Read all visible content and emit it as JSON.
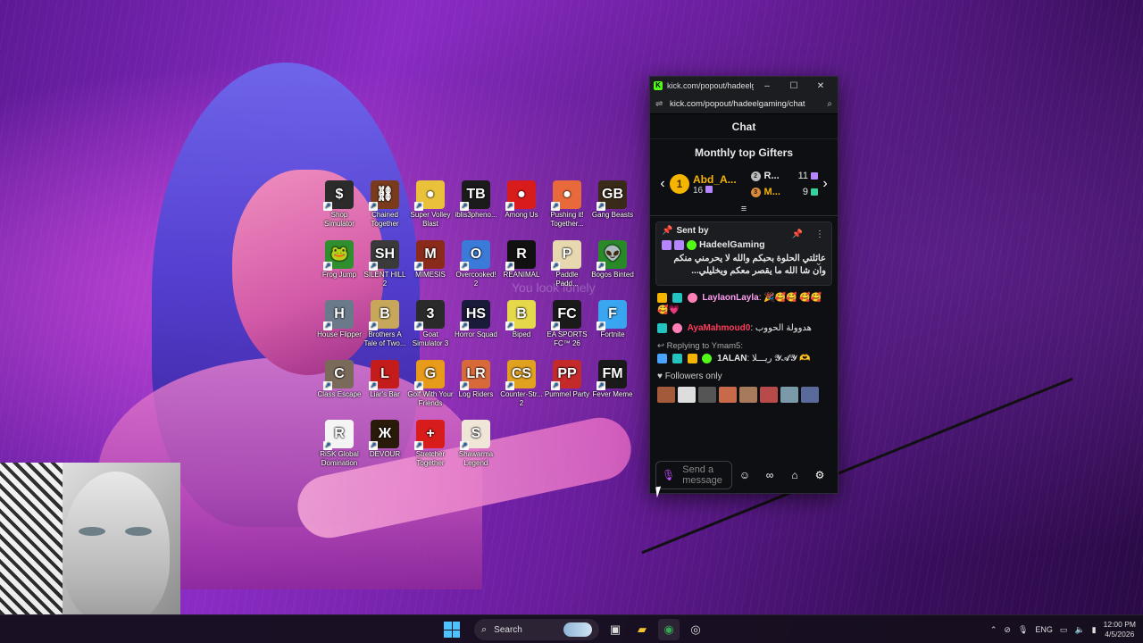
{
  "desktop": {
    "overlay_text": "You look lonely",
    "icons": [
      {
        "label": "Shop Simulator",
        "color": "#2b2b2b",
        "glyph": "$"
      },
      {
        "label": "Chained Together",
        "color": "#7a3b1c",
        "glyph": "⛓"
      },
      {
        "label": "Super Volley Blast",
        "color": "#e9c13a",
        "glyph": "●"
      },
      {
        "label": "iblis3pheno...",
        "color": "#1b1b1b",
        "glyph": "TB"
      },
      {
        "label": "Among Us",
        "color": "#d81b1b",
        "glyph": "●"
      },
      {
        "label": "Pushing it! Together...",
        "color": "#e86a3a",
        "glyph": "●"
      },
      {
        "label": "Gang Beasts",
        "color": "#3a2a1a",
        "glyph": "GB"
      },
      {
        "label": "Frog Jump",
        "color": "#2f8f2f",
        "glyph": "🐸"
      },
      {
        "label": "SILENT HILL 2",
        "color": "#3a3a3a",
        "glyph": "SH"
      },
      {
        "label": "MIMESIS",
        "color": "#8a2a1a",
        "glyph": "M"
      },
      {
        "label": "Overcooked! 2",
        "color": "#3a7ad8",
        "glyph": "O"
      },
      {
        "label": "REANIMAL",
        "color": "#111111",
        "glyph": "R"
      },
      {
        "label": "Paddle Padd...",
        "color": "#e7d8b0",
        "glyph": "P"
      },
      {
        "label": "Bogos Binted",
        "color": "#2a8a2a",
        "glyph": "👽"
      },
      {
        "label": "House Flipper",
        "color": "#6a7a8a",
        "glyph": "H"
      },
      {
        "label": "Brothers A Tale of Two...",
        "color": "#c7a85a",
        "glyph": "B"
      },
      {
        "label": "Goat Simulator 3",
        "color": "#2a2a2a",
        "glyph": "3"
      },
      {
        "label": "Horror Squad",
        "color": "#1a1a3a",
        "glyph": "HS"
      },
      {
        "label": "Biped",
        "color": "#e5d84a",
        "glyph": "B"
      },
      {
        "label": "EA SPORTS FC™ 26",
        "color": "#1a1a1a",
        "glyph": "FC"
      },
      {
        "label": "Fortnite",
        "color": "#3aa5f0",
        "glyph": "F"
      },
      {
        "label": "Class Escape",
        "color": "#7a6a5a",
        "glyph": "C"
      },
      {
        "label": "Liar's Bar",
        "color": "#c41b1b",
        "glyph": "L"
      },
      {
        "label": "Golf With Your Friends",
        "color": "#e89a1a",
        "glyph": "G"
      },
      {
        "label": "Log Riders",
        "color": "#d86a3a",
        "glyph": "LR"
      },
      {
        "label": "Counter-Str... 2",
        "color": "#e0a020",
        "glyph": "CS"
      },
      {
        "label": "Pummel Party",
        "color": "#c42a2a",
        "glyph": "PP"
      },
      {
        "label": "Fever Meme",
        "color": "#1a1a1a",
        "glyph": "FM"
      },
      {
        "label": "RiSK Global Domination",
        "color": "#f4f4f4",
        "glyph": "R"
      },
      {
        "label": "DEVOUR",
        "color": "#2a1a0a",
        "glyph": "Ж"
      },
      {
        "label": "Stretcher Together",
        "color": "#d81b1b",
        "glyph": "+"
      },
      {
        "label": "Shawarma Legend",
        "color": "#f0e6d8",
        "glyph": "S"
      }
    ]
  },
  "popup": {
    "title": "kick.com/popout/hadeelga...",
    "url": "kick.com/popout/hadeelgaming/chat",
    "chat_title": "Chat",
    "gifters_title": "Monthly top Gifters",
    "top_gifter": {
      "rank": "1",
      "name": "Abd_A...",
      "count": "16"
    },
    "second": {
      "rank": "2",
      "name": "R...",
      "count": "11"
    },
    "third": {
      "rank": "3",
      "name": "M...",
      "count": "9"
    },
    "pinned": {
      "header": "Sent by",
      "user": "HadeelGaming",
      "message": "عائلتي الحلوة بحبكم والله لا يحرمني منكم وان شا الله ما يقصر معكم ويخليلي..."
    },
    "messages": [
      {
        "user": "LaylaonLayla",
        "user_color": "#ff9ff3",
        "text": ": 🎉🥰🥰 🥰🥰🥰💗"
      },
      {
        "user": "AyaMahmoud0",
        "user_color": "#ff3b5c",
        "text": ": هدوولة الحووب"
      },
      {
        "reply": "Replying to Ymam5:",
        "user": "1ALAN",
        "user_color": "#ffffff",
        "text": ": ريـــلا 𝓨𝓐𝓨 🫶"
      }
    ],
    "followers_label": "Followers only",
    "input_placeholder": "Send a message"
  },
  "taskbar": {
    "search_label": "Search",
    "lang": "ENG",
    "time": "12:00 PM",
    "date": "4/5/2026"
  }
}
